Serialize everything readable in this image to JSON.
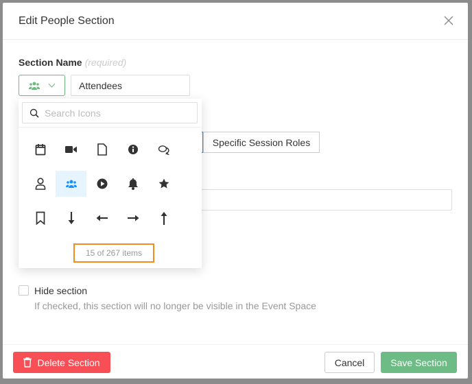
{
  "modal": {
    "title": "Edit People Section"
  },
  "section_name": {
    "label": "Section Name",
    "required": "(required)",
    "value": "Attendees",
    "selected_icon": "users-icon"
  },
  "background": {
    "segment_label": "Specific Session Roles"
  },
  "icon_picker": {
    "search_placeholder": "Search Icons",
    "icons": [
      "calendar-icon",
      "video-icon",
      "file-icon",
      "info-circle-icon",
      "comments-icon",
      "user-icon",
      "users-icon",
      "play-circle-icon",
      "bell-icon",
      "star-icon",
      "bookmark-icon",
      "arrow-down-icon",
      "arrow-left-icon",
      "arrow-right-icon",
      "arrow-up-icon"
    ],
    "selected": "users-icon",
    "count_text": "15 of 267 items"
  },
  "hide": {
    "label": "Hide section",
    "help": "If checked, this section will no longer be visible in the Event Space",
    "checked": false
  },
  "footer": {
    "delete": "Delete Section",
    "cancel": "Cancel",
    "save": "Save Section"
  },
  "colors": {
    "accent_green": "#6dbb85",
    "danger": "#f74f55",
    "highlight": "#f28c1e",
    "selected_bg": "#e6f4ff",
    "selected_icon": "#1890ff"
  }
}
